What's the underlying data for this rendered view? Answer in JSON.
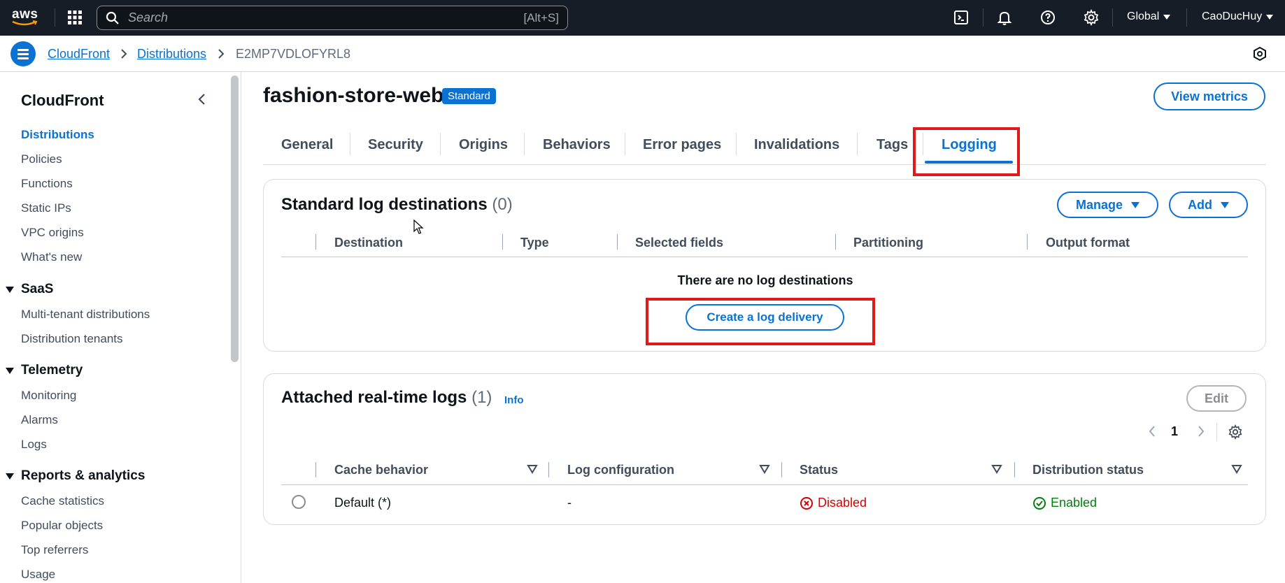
{
  "topnav": {
    "logo_text": "aws",
    "search_placeholder": "Search",
    "search_shortcut": "[Alt+S]",
    "region": "Global",
    "user": "CaoDucHuy"
  },
  "breadcrumb": {
    "items": [
      "CloudFront",
      "Distributions"
    ],
    "current": "E2MP7VDLOFYRL8"
  },
  "sidebar": {
    "title": "CloudFront",
    "items": [
      "Distributions",
      "Policies",
      "Functions",
      "Static IPs",
      "VPC origins",
      "What's new"
    ],
    "groups": [
      {
        "label": "SaaS",
        "items": [
          "Multi-tenant distributions",
          "Distribution tenants"
        ]
      },
      {
        "label": "Telemetry",
        "items": [
          "Monitoring",
          "Alarms",
          "Logs"
        ]
      },
      {
        "label": "Reports & analytics",
        "items": [
          "Cache statistics",
          "Popular objects",
          "Top referrers",
          "Usage"
        ]
      }
    ]
  },
  "page": {
    "title": "fashion-store-web",
    "badge": "Standard",
    "view_metrics": "View metrics",
    "tabs": [
      "General",
      "Security",
      "Origins",
      "Behaviors",
      "Error pages",
      "Invalidations",
      "Tags",
      "Logging"
    ],
    "active_tab": "Logging"
  },
  "standard_logs": {
    "title": "Standard log destinations",
    "count": "(0)",
    "manage_label": "Manage",
    "add_label": "Add",
    "columns": [
      "Destination",
      "Type",
      "Selected fields",
      "Partitioning",
      "Output format"
    ],
    "empty_text": "There are no log destinations",
    "create_label": "Create a log delivery"
  },
  "realtime_logs": {
    "title": "Attached real-time logs",
    "count": "(1)",
    "info": "Info",
    "edit_label": "Edit",
    "page_number": "1",
    "columns": [
      "Cache behavior",
      "Log configuration",
      "Status",
      "Distribution status"
    ],
    "rows": [
      {
        "cache_behavior": "Default (*)",
        "log_configuration": "-",
        "status": "Disabled",
        "distribution_status": "Enabled"
      }
    ]
  },
  "colors": {
    "accent": "#0972d3",
    "error": "#db0000",
    "success": "#037f0c",
    "highlight": "#e01919"
  }
}
